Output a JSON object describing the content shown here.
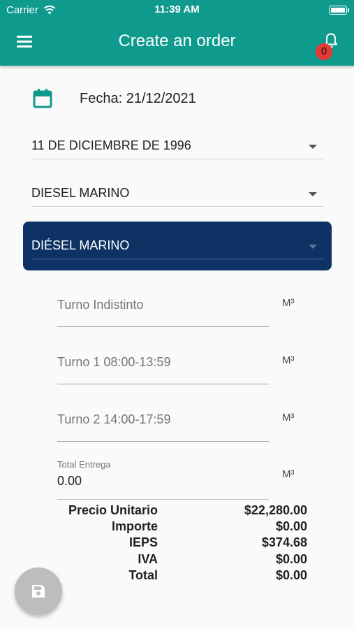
{
  "status_bar": {
    "carrier": "Carrier",
    "time": "11:39 AM"
  },
  "header": {
    "title": "Create an order",
    "notifications_count": "0"
  },
  "order": {
    "date_label": "Fecha: 21/12/2021",
    "delivery_date": "11 DE DICIEMBRE DE 1996",
    "product": "DIESEL MARINO",
    "product_selected": "DIÉSEL MARINO"
  },
  "shifts": [
    {
      "placeholder": "Turno Indistinto",
      "unit": "M³"
    },
    {
      "placeholder": "Turno 1 08:00-13:59",
      "unit": "M³"
    },
    {
      "placeholder": "Turno 2 14:00-17:59",
      "unit": "M³"
    }
  ],
  "total_entrega": {
    "label": "Total Entrega",
    "value": "0.00",
    "unit": "M³"
  },
  "summary": [
    {
      "label": "Precio Unitario",
      "value": "$22,280.00"
    },
    {
      "label": "Importe",
      "value": "$0.00"
    },
    {
      "label": "IEPS",
      "value": "$374.68"
    },
    {
      "label": "IVA",
      "value": "$0.00"
    },
    {
      "label": "Total",
      "value": "$0.00"
    }
  ],
  "icons": {
    "menu": "menu-icon",
    "notifications": "bell-icon",
    "calendar": "calendar-icon",
    "save": "save-icon"
  },
  "colors": {
    "app_bar": "#0e9a8c",
    "selected_product_bg": "#0d3263",
    "badge": "#e53935",
    "fab": "#bdbdbd"
  }
}
